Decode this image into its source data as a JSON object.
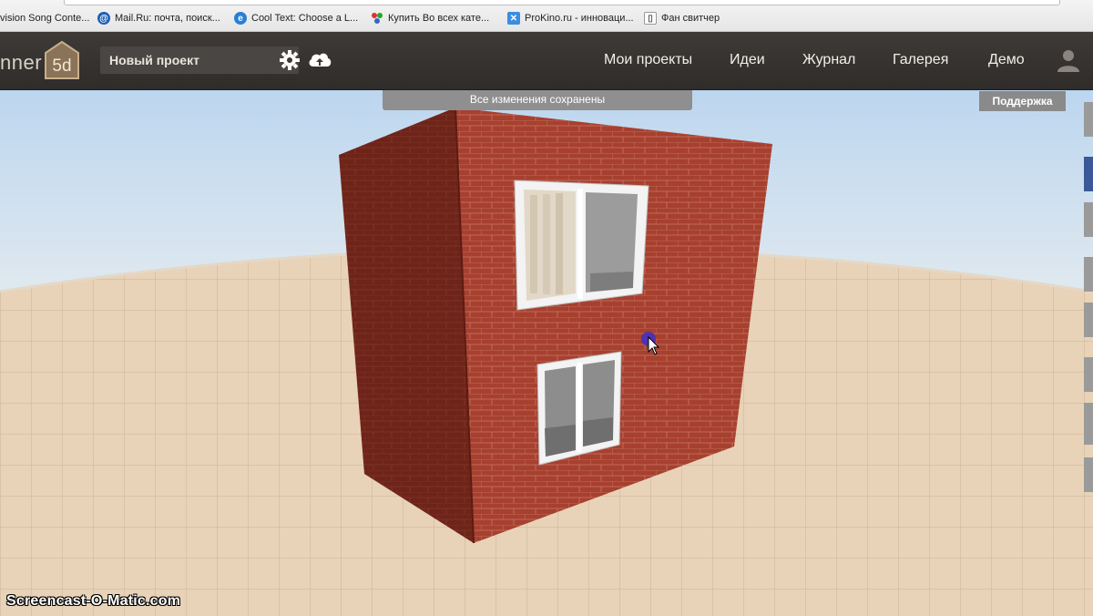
{
  "bookmarks": [
    {
      "label": "vision Song Conte...",
      "icon": "eurovision-favicon-icon",
      "color": "#555555"
    },
    {
      "label": "Mail.Ru: почта, поиск...",
      "icon": "mailru-at-icon",
      "color": "#1a5fb4"
    },
    {
      "label": "Cool Text: Choose a L...",
      "icon": "ie-favicon-icon",
      "color": "#2a7fd4"
    },
    {
      "label": "Купить Во всех кате...",
      "icon": "colorful-dots-icon",
      "color": "#d33"
    },
    {
      "label": "ProKino.ru - инноваци...",
      "icon": "prokino-x-icon",
      "color": "#3c8de0"
    },
    {
      "label": "Фан свитчер",
      "icon": "page-favicon-icon",
      "color": "#888888"
    }
  ],
  "app": {
    "logo_text": "nner",
    "logo_badge": "5d",
    "project_name": "Новый проект",
    "nav": [
      "Мои проекты",
      "Идеи",
      "Журнал",
      "Галерея",
      "Демо"
    ],
    "save_status": "Все изменения сохранены",
    "support_label": "Поддержка",
    "brand_color": "#3a3633"
  },
  "watermark": "Screencast-O-Matic.com"
}
